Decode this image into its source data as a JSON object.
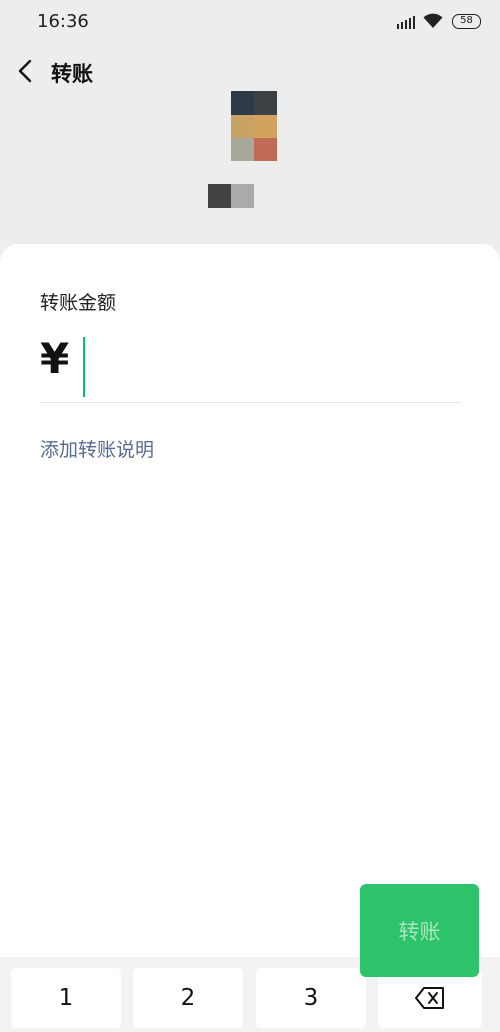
{
  "status_bar": {
    "time": "16:36",
    "battery": "58",
    "icons": [
      "signal-icon",
      "wifi-icon",
      "battery-icon"
    ]
  },
  "header": {
    "title": "转账",
    "back_icon": "chevron-left-icon"
  },
  "avatar": {
    "colors": [
      "#2e3a47",
      "#3c4145",
      "#c9a265",
      "#d2a35d",
      "#a8a89b",
      "#c06b55"
    ]
  },
  "payee_name": {
    "colors": [
      "#424242",
      "#aaaaaa"
    ]
  },
  "amount": {
    "label": "转账金额",
    "currency": "¥",
    "value": "",
    "accent_color": "#07c160"
  },
  "remark": {
    "link": "添加转账说明",
    "color": "#576b95"
  },
  "keypad": {
    "keys": [
      "1",
      "2",
      "3"
    ],
    "delete_icon": "backspace-icon"
  },
  "transfer_button": {
    "label": "转账",
    "color": "#2dc36a"
  }
}
